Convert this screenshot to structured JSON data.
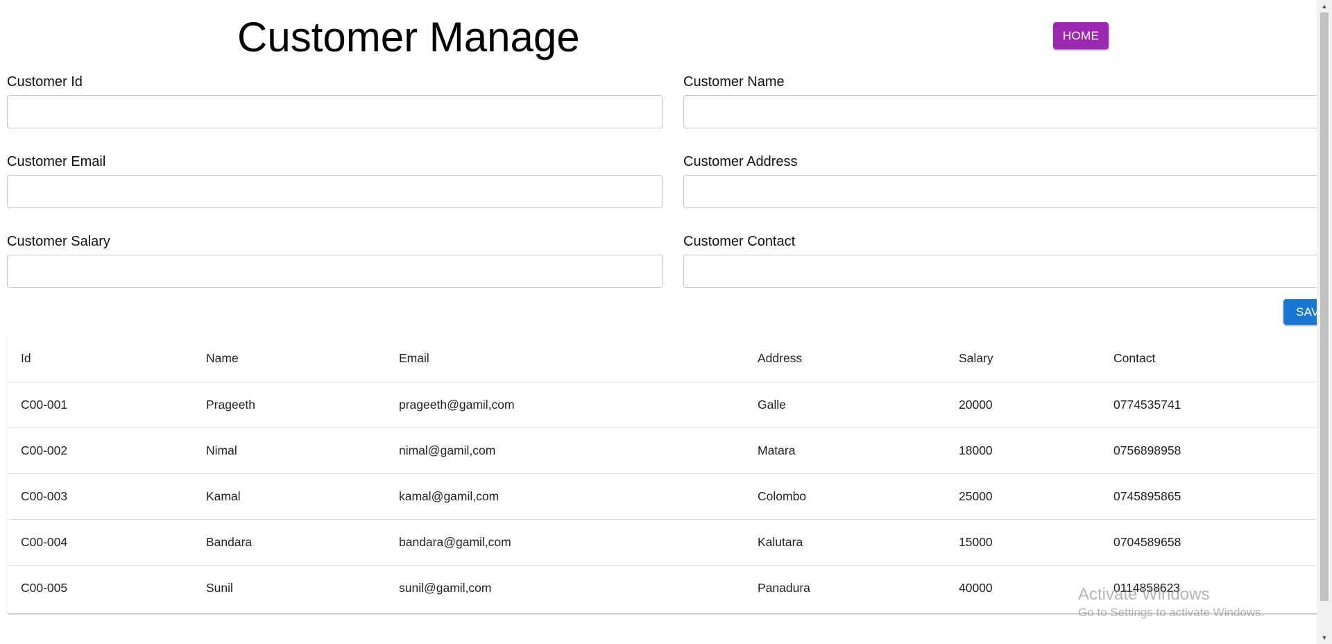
{
  "page": {
    "title": "Customer Manage",
    "home_label": "HOME",
    "save_label": "SAVE"
  },
  "form": {
    "customer_id": {
      "label": "Customer Id",
      "value": ""
    },
    "customer_name": {
      "label": "Customer Name",
      "value": ""
    },
    "customer_email": {
      "label": "Customer Email",
      "value": ""
    },
    "customer_address": {
      "label": "Customer Address",
      "value": ""
    },
    "customer_salary": {
      "label": "Customer Salary",
      "value": ""
    },
    "customer_contact": {
      "label": "Customer Contact",
      "value": ""
    }
  },
  "table": {
    "headers": [
      "Id",
      "Name",
      "Email",
      "Address",
      "Salary",
      "Contact"
    ],
    "rows": [
      [
        "C00-001",
        "Prageeth",
        "prageeth@gamil,com",
        "Galle",
        "20000",
        "0774535741"
      ],
      [
        "C00-002",
        "Nimal",
        "nimal@gamil,com",
        "Matara",
        "18000",
        "0756898958"
      ],
      [
        "C00-003",
        "Kamal",
        "kamal@gamil,com",
        "Colombo",
        "25000",
        "0745895865"
      ],
      [
        "C00-004",
        "Bandara",
        "bandara@gamil,com",
        "Kalutara",
        "15000",
        "0704589658"
      ],
      [
        "C00-005",
        "Sunil",
        "sunil@gamil,com",
        "Panadura",
        "40000",
        "0114858623"
      ]
    ]
  },
  "watermark": {
    "title": "Activate Windows",
    "subtitle": "Go to Settings to activate Windows."
  },
  "colors": {
    "home_button": "#9c27b0",
    "save_button": "#1976d2"
  },
  "icons": {
    "scroll_up": "triangle-up-icon",
    "scroll_down": "triangle-down-icon"
  }
}
